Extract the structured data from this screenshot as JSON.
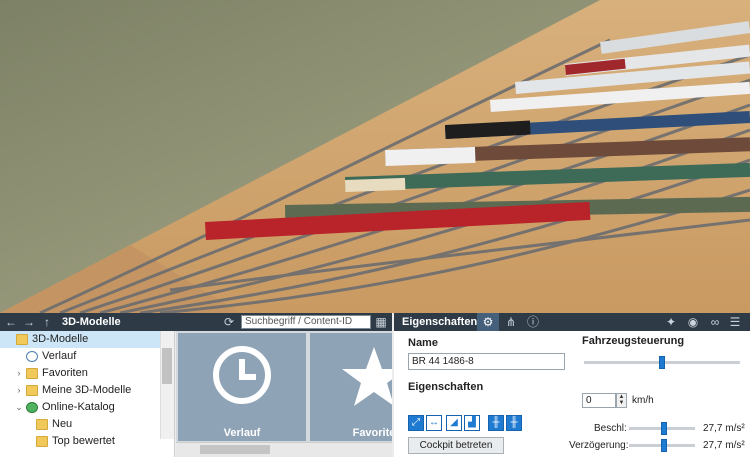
{
  "nav": {
    "title": "3D-Modelle",
    "search_placeholder": "Suchbegriff / Content-ID"
  },
  "tree": [
    {
      "label": "3D-Modelle",
      "icon": "folder-icon",
      "selected": true
    },
    {
      "label": "Verlauf",
      "icon": "clock-icon"
    },
    {
      "label": "Favoriten",
      "icon": "folder-icon"
    },
    {
      "label": "Meine 3D-Modelle",
      "icon": "folder-icon"
    },
    {
      "label": "Online-Katalog",
      "icon": "globe-icon"
    },
    {
      "label": "Neu",
      "icon": "star-icon"
    },
    {
      "label": "Top bewertet",
      "icon": "folder-icon"
    }
  ],
  "tiles": [
    {
      "label": "Verlauf",
      "icon": "clock-icon"
    },
    {
      "label": "Favorite",
      "icon": "star-icon"
    }
  ],
  "properties": {
    "tab_title": "Eigenschaften",
    "name_heading": "Name",
    "name_value": "BR 44 1486-8",
    "props_heading": "Eigenschaften",
    "cockpit_button": "Cockpit betreten"
  },
  "control": {
    "heading": "Fahrzeugsteuerung",
    "speed_value": "0",
    "speed_unit": "km/h",
    "speed_level": 0.5,
    "accel_label": "Beschl:",
    "accel_value": "27,7 m/s²",
    "accel_level": 0.55,
    "decel_label": "Verzögerung:",
    "decel_value": "27,7 m/s²",
    "decel_level": 0.55
  },
  "colors": {
    "toolbar": "#2e3b47",
    "accent": "#1f7bd1",
    "tile": "#8fa3b6"
  }
}
